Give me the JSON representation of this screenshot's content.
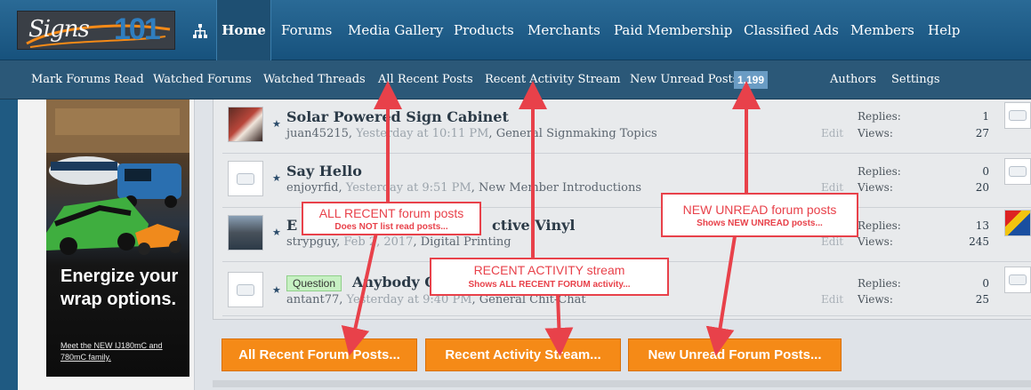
{
  "header": {
    "logo_text": "Signs101",
    "nav": [
      {
        "label": "Home"
      },
      {
        "label": "Forums"
      },
      {
        "label": "Media Gallery"
      },
      {
        "label": "Products"
      },
      {
        "label": "Merchants"
      },
      {
        "label": "Paid Membership"
      },
      {
        "label": "Classified Ads"
      },
      {
        "label": "Members"
      },
      {
        "label": "Help"
      }
    ]
  },
  "subnav": {
    "items": [
      {
        "label": "Mark Forums Read"
      },
      {
        "label": "Watched Forums"
      },
      {
        "label": "Watched Threads"
      },
      {
        "label": "All Recent Posts"
      },
      {
        "label": "Recent Activity Stream"
      },
      {
        "label": "New Unread Posts"
      },
      {
        "label": "Authors"
      },
      {
        "label": "Settings"
      }
    ],
    "unread_count": "1,199"
  },
  "ad": {
    "headline": "Energize your wrap options.",
    "sub_link": "Meet the NEW IJ180mC and 780mC family."
  },
  "threads": [
    {
      "title": "Solar Powered Sign Cabinet",
      "author": "juan45215",
      "time": "Yesterday at 10:11 PM",
      "forum": "General Signmaking Topics",
      "edit": "Edit",
      "replies_label": "Replies:",
      "replies": "1",
      "views_label": "Views:",
      "views": "27"
    },
    {
      "title": "Say Hello",
      "author": "enjoyrfid",
      "time": "Yesterday at 9:51 PM",
      "forum": "New Member Introductions",
      "edit": "Edit",
      "replies_label": "Replies:",
      "replies": "0",
      "views_label": "Views:",
      "views": "20"
    },
    {
      "title": "E",
      "title_end": "ctive Vinyl",
      "author": "strypguy",
      "time": "Feb 2, 2017",
      "forum": "Digital Printing",
      "edit": "Edit",
      "replies_label": "Replies:",
      "replies": "13",
      "views_label": "Views:",
      "views": "245"
    },
    {
      "prefix": "Question",
      "title": "Anybody Or",
      "author": "antant77",
      "time": "Yesterday at 9:40 PM",
      "forum": "General Chit-Chat",
      "edit": "Edit",
      "replies_label": "Replies:",
      "replies": "0",
      "views_label": "Views:",
      "views": "25"
    }
  ],
  "callouts": {
    "all_recent": {
      "title": "ALL RECENT forum posts",
      "sub": "Does NOT list read posts..."
    },
    "recent_activity": {
      "title": "RECENT ACTIVITY stream",
      "sub": "Shows ALL RECENT FORUM activity..."
    },
    "new_unread": {
      "title": "NEW UNREAD forum posts",
      "sub": "Shows NEW UNREAD posts..."
    }
  },
  "buttons": {
    "all_recent": "All Recent Forum Posts...",
    "recent_activity": "Recent Activity Stream...",
    "new_unread": "New Unread Forum Posts..."
  },
  "colors": {
    "nav_bg": "#1f5a82",
    "subnav_bg": "#2b5878",
    "accent_orange": "#f58a17",
    "callout_red": "#e8414a",
    "badge_bg": "#6a9cc4"
  }
}
